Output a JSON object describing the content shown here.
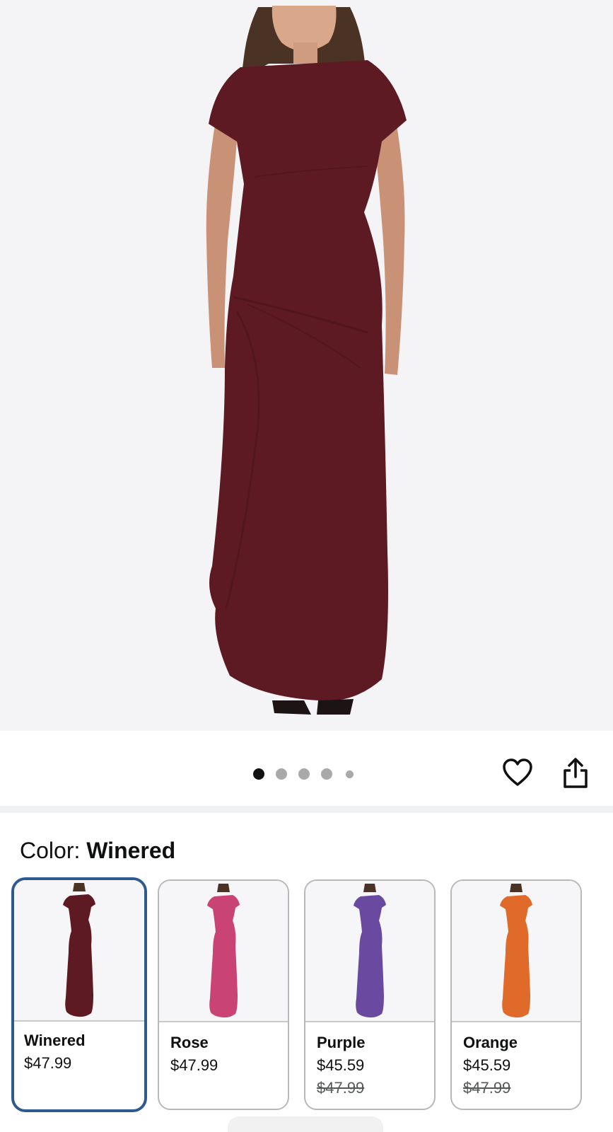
{
  "product": {
    "image_alt": "Model wearing a winered ruched maxi dress",
    "gallery_total_dots": 5,
    "gallery_active_index": 0
  },
  "color": {
    "label": "Color: ",
    "selected": "Winered"
  },
  "swatches": [
    {
      "name": "Winered",
      "price": "$47.99",
      "old_price": "",
      "color": "#5e1a22",
      "selected": true
    },
    {
      "name": "Rose",
      "price": "$47.99",
      "old_price": "",
      "color": "#c94474",
      "selected": false
    },
    {
      "name": "Purple",
      "price": "$45.59",
      "old_price": "$47.99",
      "color": "#6a4aa0",
      "selected": false
    },
    {
      "name": "Orange",
      "price": "$45.59",
      "old_price": "$47.99",
      "color": "#e06a2a",
      "selected": false
    }
  ],
  "icons": {
    "wishlist": "heart-icon",
    "share": "share-icon"
  },
  "colors": {
    "hero_background": "#f4f3f5",
    "dress": "#5e1a22",
    "selected_border": "#2e5b8f"
  }
}
